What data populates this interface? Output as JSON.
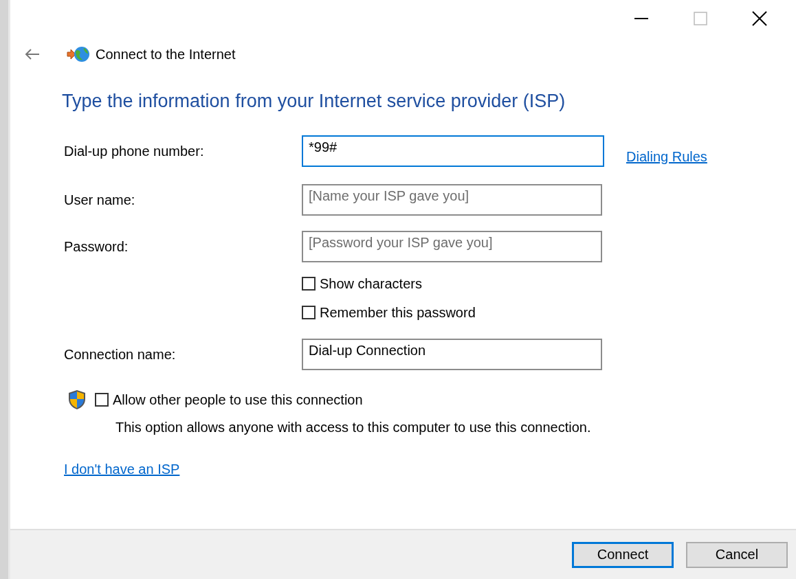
{
  "header": {
    "title": "Connect to the Internet"
  },
  "heading": "Type the information from your Internet service provider (ISP)",
  "rows": [
    {
      "kind": "field",
      "label": "Dial-up phone number:",
      "value": "*99#",
      "focused": true,
      "link": "Dialing Rules"
    },
    {
      "kind": "field",
      "label": "User name:",
      "placeholder": "[Name your ISP gave you]",
      "focused": false
    },
    {
      "kind": "field",
      "label": "Password:",
      "placeholder": "[Password your ISP gave you]",
      "focused": false
    },
    {
      "kind": "checkbox",
      "label": "Show characters",
      "checked": false
    },
    {
      "kind": "checkbox",
      "label": "Remember this password",
      "checked": false
    },
    {
      "kind": "field",
      "label": "Connection name:",
      "value": "Dial-up Connection",
      "focused": false
    }
  ],
  "share": {
    "label": "Allow other people to use this connection",
    "checked": false,
    "description": "This option allows anyone with access to this computer to use this connection."
  },
  "no_isp_link": "I don't have an ISP",
  "buttons": [
    {
      "label": "Connect",
      "default": true
    },
    {
      "label": "Cancel",
      "default": false
    }
  ]
}
